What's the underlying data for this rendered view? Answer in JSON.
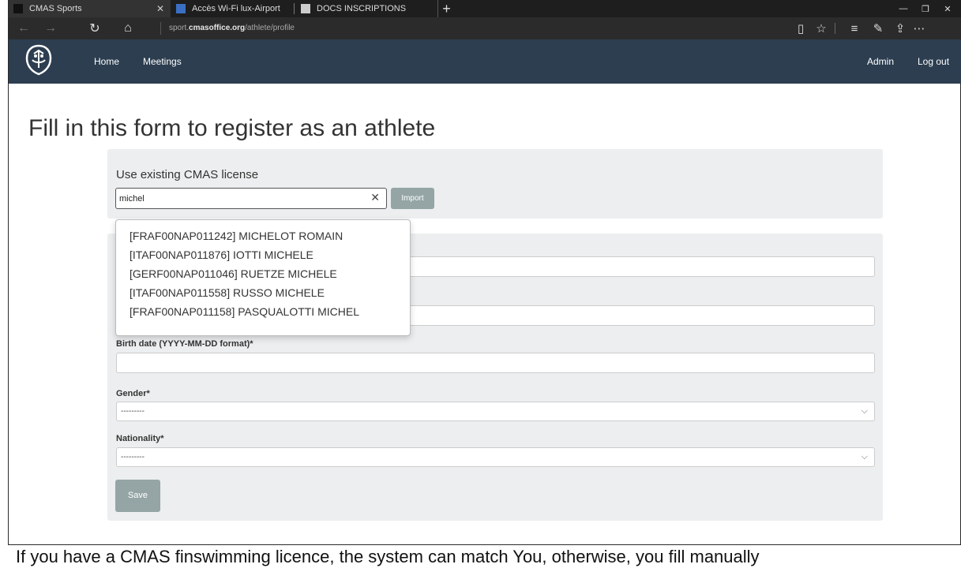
{
  "browser": {
    "tabs": [
      {
        "title": "CMAS Sports",
        "active": true
      },
      {
        "title": "Accès Wi-Fi lux-Airport",
        "active": false
      },
      {
        "title": "DOCS INSCRIPTIONS",
        "active": false
      }
    ],
    "url_prefix": "sport.",
    "url_domain": "cmasoffice.org",
    "url_path": "/athlete/profile"
  },
  "nav": {
    "home": "Home",
    "meetings": "Meetings",
    "admin": "Admin",
    "logout": "Log out"
  },
  "page": {
    "title": "Fill in this form to register as an athlete"
  },
  "license": {
    "heading": "Use existing CMAS license",
    "search_value": "michel",
    "import_label": "Import",
    "suggestions": [
      "[FRAF00NAP011242] MICHELOT ROMAIN",
      "[ITAF00NAP011876] IOTTI MICHELE",
      "[GERF00NAP011046] RUETZE MICHELE",
      "[ITAF00NAP011558] RUSSO MICHELE",
      "[FRAF00NAP011158] PASQUALOTTI MICHEL"
    ]
  },
  "form": {
    "birth_label": "Birth date (YYYY-MM-DD format)*",
    "gender_label": "Gender*",
    "gender_value": "---------",
    "nationality_label": "Nationality*",
    "nationality_value": "---------",
    "save_label": "Save"
  },
  "caption": "If you have a CMAS finswimming licence, the system can match You, otherwise, you fill manually",
  "colors": {
    "navbar": "#2c3e50",
    "panel": "#eceeef",
    "button": "#95a5a6"
  }
}
